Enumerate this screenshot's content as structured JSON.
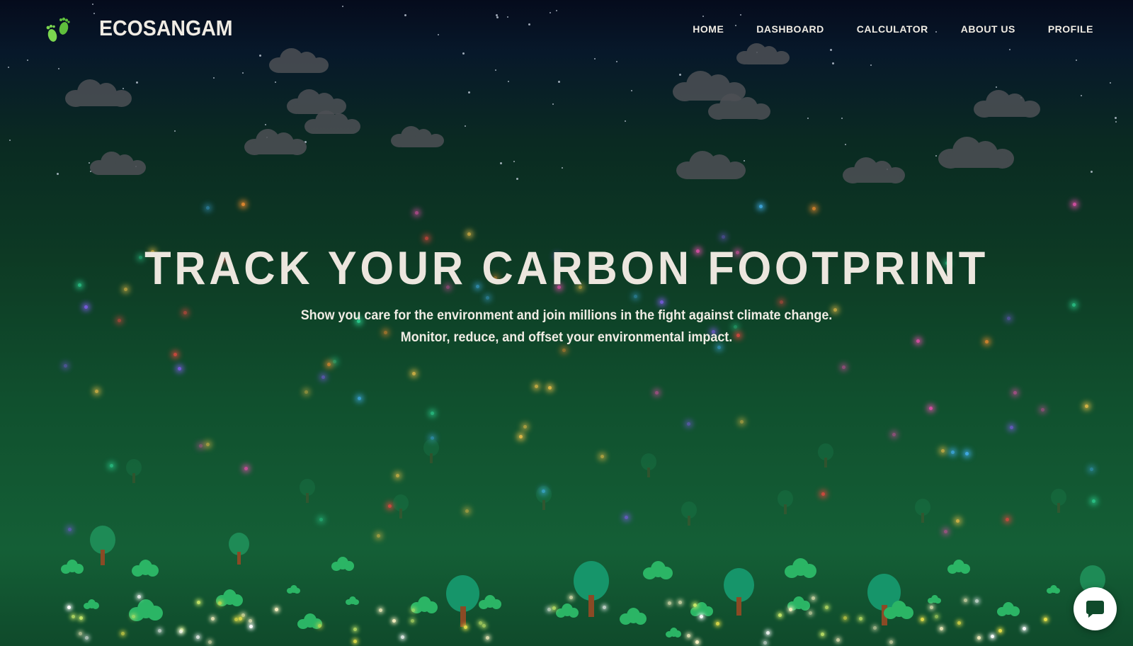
{
  "brand": {
    "name": "ECOSANGAM",
    "logo_icon": "footprints-icon",
    "logo_color": "#7bd64f"
  },
  "nav": {
    "items": [
      {
        "label": "HOME"
      },
      {
        "label": "DASHBOARD"
      },
      {
        "label": "CALCULATOR"
      },
      {
        "label": "ABOUT US"
      },
      {
        "label": "PROFILE"
      }
    ]
  },
  "hero": {
    "title": "TRACK YOUR CARBON FOOTPRINT",
    "subtitle_line1": "Show you care for the environment and join millions in the fight against climate change.",
    "subtitle_line2": "Monitor, reduce, and offset your environmental impact."
  },
  "chat": {
    "icon": "chat-bubble-icon",
    "icon_color": "#0f4a2b"
  },
  "colors": {
    "sky_top": "#050b1c",
    "ground": "#145f36",
    "text": "#f0ece4",
    "cloud": "#4d5055",
    "tree": "#1e8b56",
    "trunk": "#8a4a25"
  }
}
